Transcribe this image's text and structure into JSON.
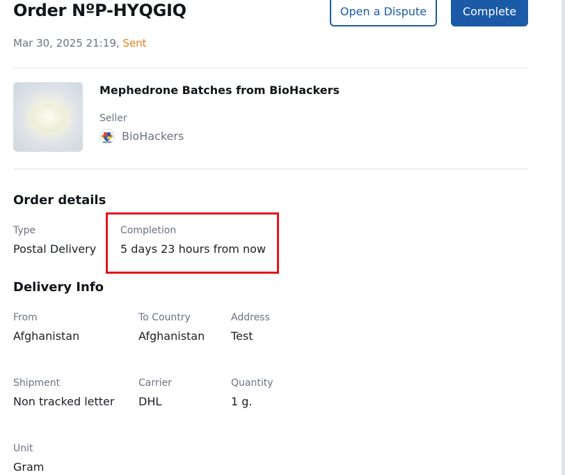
{
  "order": {
    "title": "Order NºP-HYQGIQ",
    "date": "Mar 30, 2025 21:19,",
    "status": "Sent",
    "dispute_label": "Open a Dispute",
    "complete_label": "Complete"
  },
  "product": {
    "name": "Mephedrone Batches from BioHackers",
    "image_icon": "white-powder-image",
    "seller_label": "Seller",
    "seller_name": "BioHackers",
    "seller_avatar_icon": "crest-avatar-icon"
  },
  "order_details": {
    "heading": "Order details",
    "type_label": "Type",
    "type_value": "Postal Delivery",
    "completion_label": "Completion",
    "completion_value": "5 days 23 hours from now"
  },
  "delivery": {
    "heading": "Delivery Info",
    "from_label": "From",
    "from_value": "Afghanistan",
    "to_country_label": "To Country",
    "to_country_value": "Afghanistan",
    "address_label": "Address",
    "address_value": "Test",
    "shipment_label": "Shipment",
    "shipment_value": "Non tracked letter",
    "carrier_label": "Carrier",
    "carrier_value": "DHL",
    "quantity_label": "Quantity",
    "quantity_value": "1 g.",
    "unit_label": "Unit",
    "unit_value": "Gram"
  },
  "colors": {
    "accent": "#1b5aa7",
    "status_sent": "#ef7d1a",
    "highlight": "#e3141c"
  }
}
